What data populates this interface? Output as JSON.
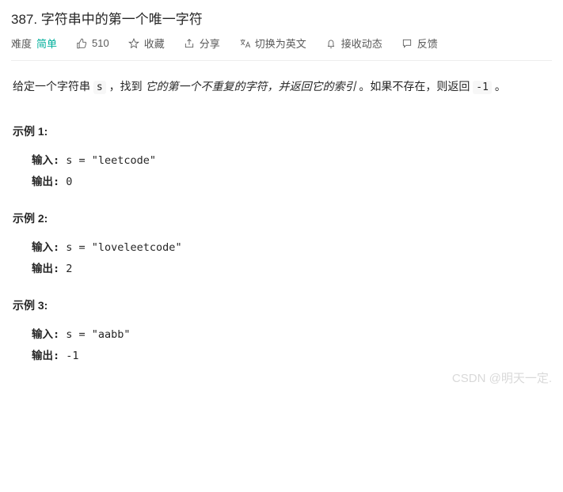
{
  "header": {
    "title": "387. 字符串中的第一个唯一字符",
    "difficulty_label": "难度",
    "difficulty_value": "简单",
    "likes_count": "510",
    "favorite_label": "收藏",
    "share_label": "分享",
    "switch_label": "切换为英文",
    "notify_label": "接收动态",
    "feedback_label": "反馈"
  },
  "description": {
    "prefix": "给定一个字符串 ",
    "var": "s",
    "mid1": " ，找到 ",
    "italic": "它的第一个不重复的字符，并返回它的索引",
    "mid2": " 。如果不存在，则返回 ",
    "neg1": "-1",
    "suffix": " 。"
  },
  "examples": [
    {
      "title": "示例 1:",
      "input_label": "输入:",
      "input_value": " s = \"leetcode\"",
      "output_label": "输出:",
      "output_value": " 0"
    },
    {
      "title": "示例 2:",
      "input_label": "输入:",
      "input_value": " s = \"loveleetcode\"",
      "output_label": "输出:",
      "output_value": " 2"
    },
    {
      "title": "示例 3:",
      "input_label": "输入:",
      "input_value": " s = \"aabb\"",
      "output_label": "输出:",
      "output_value": " -1"
    }
  ],
  "watermark": "CSDN @明天一定."
}
